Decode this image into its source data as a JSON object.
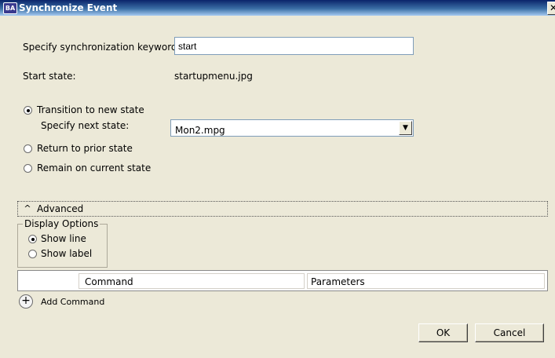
{
  "window": {
    "title": "Synchronize Event",
    "app_icon_text": "BA",
    "close_glyph": "✕"
  },
  "keyword": {
    "label": "Specify synchronization keyword",
    "value": "start"
  },
  "start_state": {
    "label": "Start state:",
    "value": "startupmenu.jpg"
  },
  "options": {
    "transition_label": "Transition to new state",
    "next_state_label": "Specify next state:",
    "next_state_value": "Mon2.mpg",
    "return_label": "Return to prior state",
    "remain_label": "Remain on current state",
    "selected": "transition"
  },
  "advanced": {
    "label": "Advanced",
    "chevron": "^"
  },
  "display_options": {
    "legend": "Display Options",
    "show_line_label": "Show line",
    "show_label_label": "Show label",
    "selected": "show_line"
  },
  "commands_table": {
    "columns": [
      "Command",
      "Parameters"
    ]
  },
  "add_command": {
    "label": "Add Command",
    "glyph": "+"
  },
  "buttons": {
    "ok": "OK",
    "cancel": "Cancel"
  },
  "icons": {
    "app": "app-icon",
    "close": "close-icon",
    "dropdown": "chevron-down-icon",
    "advanced": "chevron-up-icon",
    "add": "plus-circle-icon"
  },
  "colors": {
    "titlebar": "#0a246a",
    "dialog_bg": "#ece9d8",
    "field_border": "#7f9db9"
  }
}
